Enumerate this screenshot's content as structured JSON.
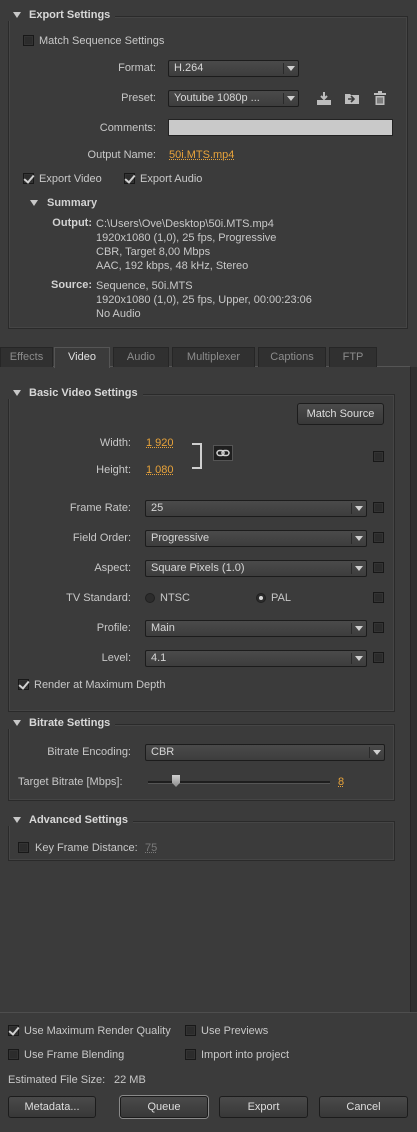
{
  "export_settings": {
    "title": "Export Settings",
    "match_sequence_label": "Match Sequence Settings",
    "match_sequence_checked": false,
    "format_label": "Format:",
    "format_value": "H.264",
    "preset_label": "Preset:",
    "preset_value": "Youtube 1080p ...",
    "comments_label": "Comments:",
    "comments_value": "",
    "output_name_label": "Output Name:",
    "output_name_value": "50i.MTS.mp4",
    "export_video_label": "Export Video",
    "export_video_checked": true,
    "export_audio_label": "Export Audio",
    "export_audio_checked": true,
    "summary": {
      "title": "Summary",
      "output_label": "Output:",
      "output_lines": [
        "C:\\Users\\Ove\\Desktop\\50i.MTS.mp4",
        "1920x1080 (1,0), 25 fps, Progressive",
        "CBR, Target 8,00 Mbps",
        "AAC, 192 kbps, 48 kHz, Stereo"
      ],
      "source_label": "Source:",
      "source_lines": [
        "Sequence, 50i.MTS",
        "1920x1080 (1,0), 25 fps, Upper, 00:00:23:06",
        "No Audio"
      ]
    }
  },
  "tabs": [
    "Effects",
    "Video",
    "Audio",
    "Multiplexer",
    "Captions",
    "FTP"
  ],
  "active_tab": "Video",
  "basic_video": {
    "title": "Basic Video Settings",
    "match_source_label": "Match Source",
    "width_label": "Width:",
    "width_value": "1 920",
    "height_label": "Height:",
    "height_value": "1 080",
    "frame_rate_label": "Frame Rate:",
    "frame_rate_value": "25",
    "field_order_label": "Field Order:",
    "field_order_value": "Progressive",
    "aspect_label": "Aspect:",
    "aspect_value": "Square Pixels (1.0)",
    "tv_standard_label": "TV Standard:",
    "tv_ntsc_label": "NTSC",
    "tv_pal_label": "PAL",
    "tv_selected": "PAL",
    "profile_label": "Profile:",
    "profile_value": "Main",
    "level_label": "Level:",
    "level_value": "4.1",
    "render_max_depth_label": "Render at Maximum Depth",
    "render_max_depth_checked": true
  },
  "bitrate": {
    "title": "Bitrate Settings",
    "encoding_label": "Bitrate Encoding:",
    "encoding_value": "CBR",
    "target_label": "Target Bitrate [Mbps]:",
    "target_value": "8"
  },
  "advanced": {
    "title": "Advanced Settings",
    "key_frame_label": "Key Frame Distance:",
    "key_frame_value": "75",
    "key_frame_checked": false
  },
  "footer": {
    "max_render_quality_label": "Use Maximum Render Quality",
    "max_render_quality_checked": true,
    "use_previews_label": "Use Previews",
    "use_previews_checked": false,
    "frame_blending_label": "Use Frame Blending",
    "frame_blending_checked": false,
    "import_label": "Import into project",
    "import_checked": false,
    "file_size_label": "Estimated File Size:",
    "file_size_value": "22 MB",
    "metadata_button": "Metadata...",
    "queue_button": "Queue",
    "export_button": "Export",
    "cancel_button": "Cancel"
  },
  "colors": {
    "accent": "#e8a33a",
    "panel": "#3b3b3b"
  }
}
